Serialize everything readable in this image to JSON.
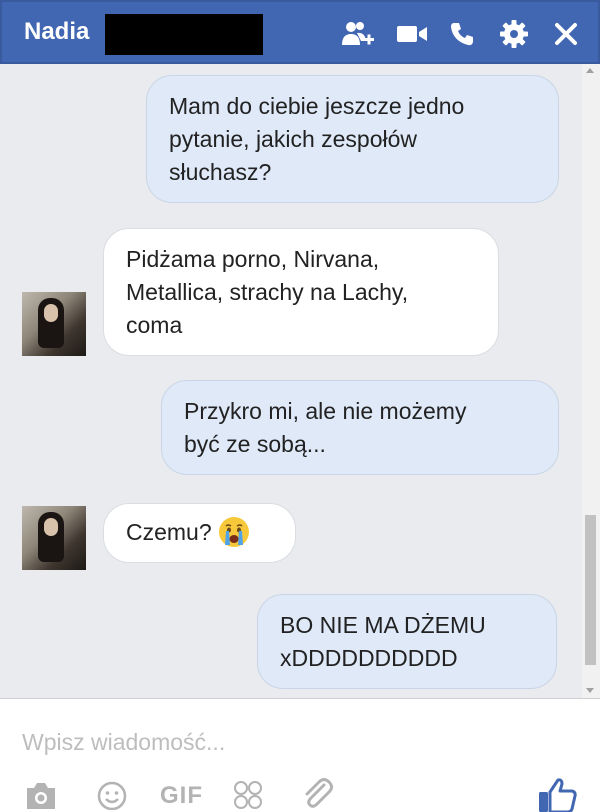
{
  "header": {
    "title": "Nadia",
    "bg_color": "#4267b2",
    "icons": [
      "add-people-icon",
      "video-call-icon",
      "phone-icon",
      "gear-icon",
      "close-icon"
    ]
  },
  "messages": [
    {
      "from": "me",
      "text_lines": [
        "Mam do ciebie jeszcze jedno",
        "pytanie, jakich zespołów",
        "słuchasz?"
      ]
    },
    {
      "from": "them",
      "text_lines": [
        "Pidżama porno, Nirvana,",
        "Metallica, strachy na Lachy,",
        "coma"
      ]
    },
    {
      "from": "me",
      "text_lines": [
        "Przykro mi, ale nie możemy",
        "być ze sobą..."
      ]
    },
    {
      "from": "them",
      "text_lines": [
        "Czemu?"
      ],
      "emoji": "crying-face-icon"
    },
    {
      "from": "me",
      "text_lines": [
        "BO NIE MA DŻEMU",
        "xDDDDDDDDDD"
      ]
    }
  ],
  "composer": {
    "placeholder": "Wpisz wiadomość...",
    "gif_label": "GIF",
    "icons": [
      "camera-icon",
      "smiley-icon",
      "gif-icon",
      "stickers-icon",
      "attachment-icon",
      "thumbs-up-icon"
    ],
    "accent_color": "#4267b2"
  }
}
